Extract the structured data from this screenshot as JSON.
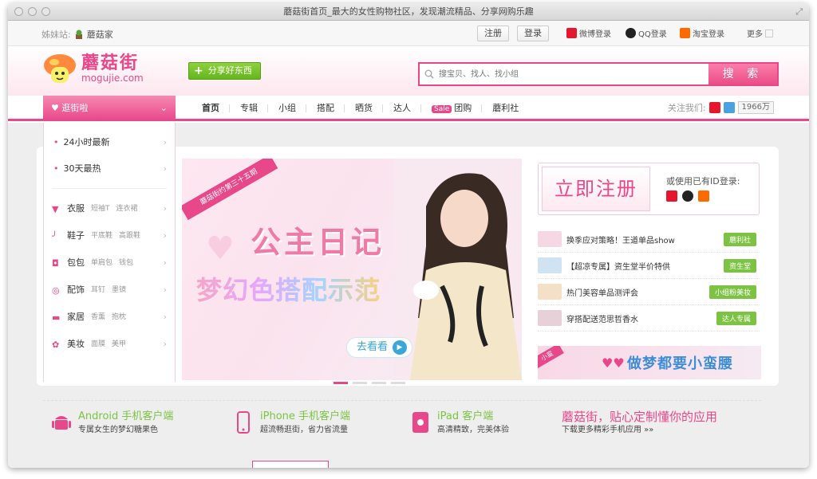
{
  "window": {
    "title": "蘑菇街首页_最大的女性购物社区，发现潮流精品、分享网购乐趣"
  },
  "topbar": {
    "sister_label": "姊妹站:",
    "sister_name": "蘑菇家",
    "register": "注册",
    "login": "登录",
    "weibo_login": "微博登录",
    "qq_login": "QQ登录",
    "taobao_login": "淘宝登录",
    "more": "更多"
  },
  "header": {
    "logo_cn": "蘑菇街",
    "logo_en": "mogujie.com",
    "share_label": "分享好东西",
    "search_placeholder": "搜宝贝、找人、找小组",
    "search_button": "搜 索"
  },
  "nav": {
    "category_button": "逛街啦",
    "links": [
      "首页",
      "专辑",
      "小组",
      "搭配",
      "晒货",
      "达人",
      "团购",
      "蘑利社"
    ],
    "sale_badge": "Sale",
    "follow_label": "关注我们:",
    "follow_count": "1966万"
  },
  "sidebar": {
    "top_items": [
      "24小时最新",
      "30天最热"
    ],
    "categories": [
      {
        "name": "衣服",
        "subs": [
          "短袖T",
          "连衣裙"
        ],
        "icon": "dress-icon"
      },
      {
        "name": "鞋子",
        "subs": [
          "平底鞋",
          "高跟鞋"
        ],
        "icon": "shoe-icon"
      },
      {
        "name": "包包",
        "subs": [
          "单肩包",
          "钱包"
        ],
        "icon": "bag-icon"
      },
      {
        "name": "配饰",
        "subs": [
          "耳钉",
          "墨镜"
        ],
        "icon": "accessory-icon"
      },
      {
        "name": "家居",
        "subs": [
          "香薰",
          "抱枕"
        ],
        "icon": "home-icon"
      },
      {
        "name": "美妆",
        "subs": [
          "面膜",
          "美甲"
        ],
        "icon": "makeup-icon"
      }
    ]
  },
  "banner": {
    "ribbon": "蘑菇街约第三十五期",
    "title": "公主日记",
    "subtitle": "梦幻色搭配示范",
    "cta": "去看看"
  },
  "register_box": {
    "button": "立即注册",
    "or_label": "或使用已有ID登录:"
  },
  "news": [
    {
      "text": "换季应对策略！王道单品show",
      "tag": "蘑利社",
      "thumb_color": "#f6d8e4"
    },
    {
      "text": "【超凉专属】资生堂半价特供",
      "tag": "资生堂",
      "thumb_color": "#cfe3f3"
    },
    {
      "text": "热门美容单品测评会",
      "tag": "小组粉美妆",
      "thumb_color": "#f3e0c7"
    },
    {
      "text": "穿搭配送范思哲香水",
      "tag": "达人专属",
      "thumb_color": "#e8d0d8"
    }
  ],
  "mini_banner": {
    "ribbon": "小蛮",
    "text": "做梦都要小蛮腰"
  },
  "apps": [
    {
      "title": "Android 手机客户端",
      "desc": "专属女生的梦幻糖果色"
    },
    {
      "title": "iPhone 手机客户端",
      "desc": "超流畅逛街，省力省流量"
    },
    {
      "title": "iPad 客户端",
      "desc": "高清精致，完美体验"
    },
    {
      "title": "蘑菇街，贴心定制懂你的应用",
      "desc": "下载更多精彩手机应用 »»"
    }
  ],
  "colors": {
    "brand_pink": "#e8478a",
    "green": "#7cc243",
    "blue": "#3ba6d8"
  }
}
